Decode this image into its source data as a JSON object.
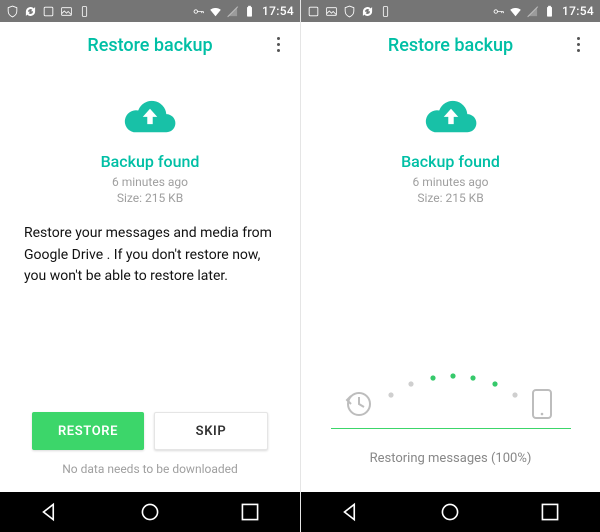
{
  "statusbar": {
    "time": "17:54"
  },
  "header": {
    "title": "Restore backup"
  },
  "backup": {
    "found_title": "Backup found",
    "age": "6 minutes ago",
    "size": "Size: 215 KB"
  },
  "left": {
    "body": "Restore your messages and media from Google Drive . If you don't restore now, you won't be able to restore later.",
    "restore_btn": "RESTORE",
    "skip_btn": "SKIP",
    "footer": "No data needs to be downloaded"
  },
  "right": {
    "progress_text": "Restoring messages (100%)"
  },
  "colors": {
    "accent": "#00bfa5",
    "primary_btn": "#3cd66a"
  }
}
